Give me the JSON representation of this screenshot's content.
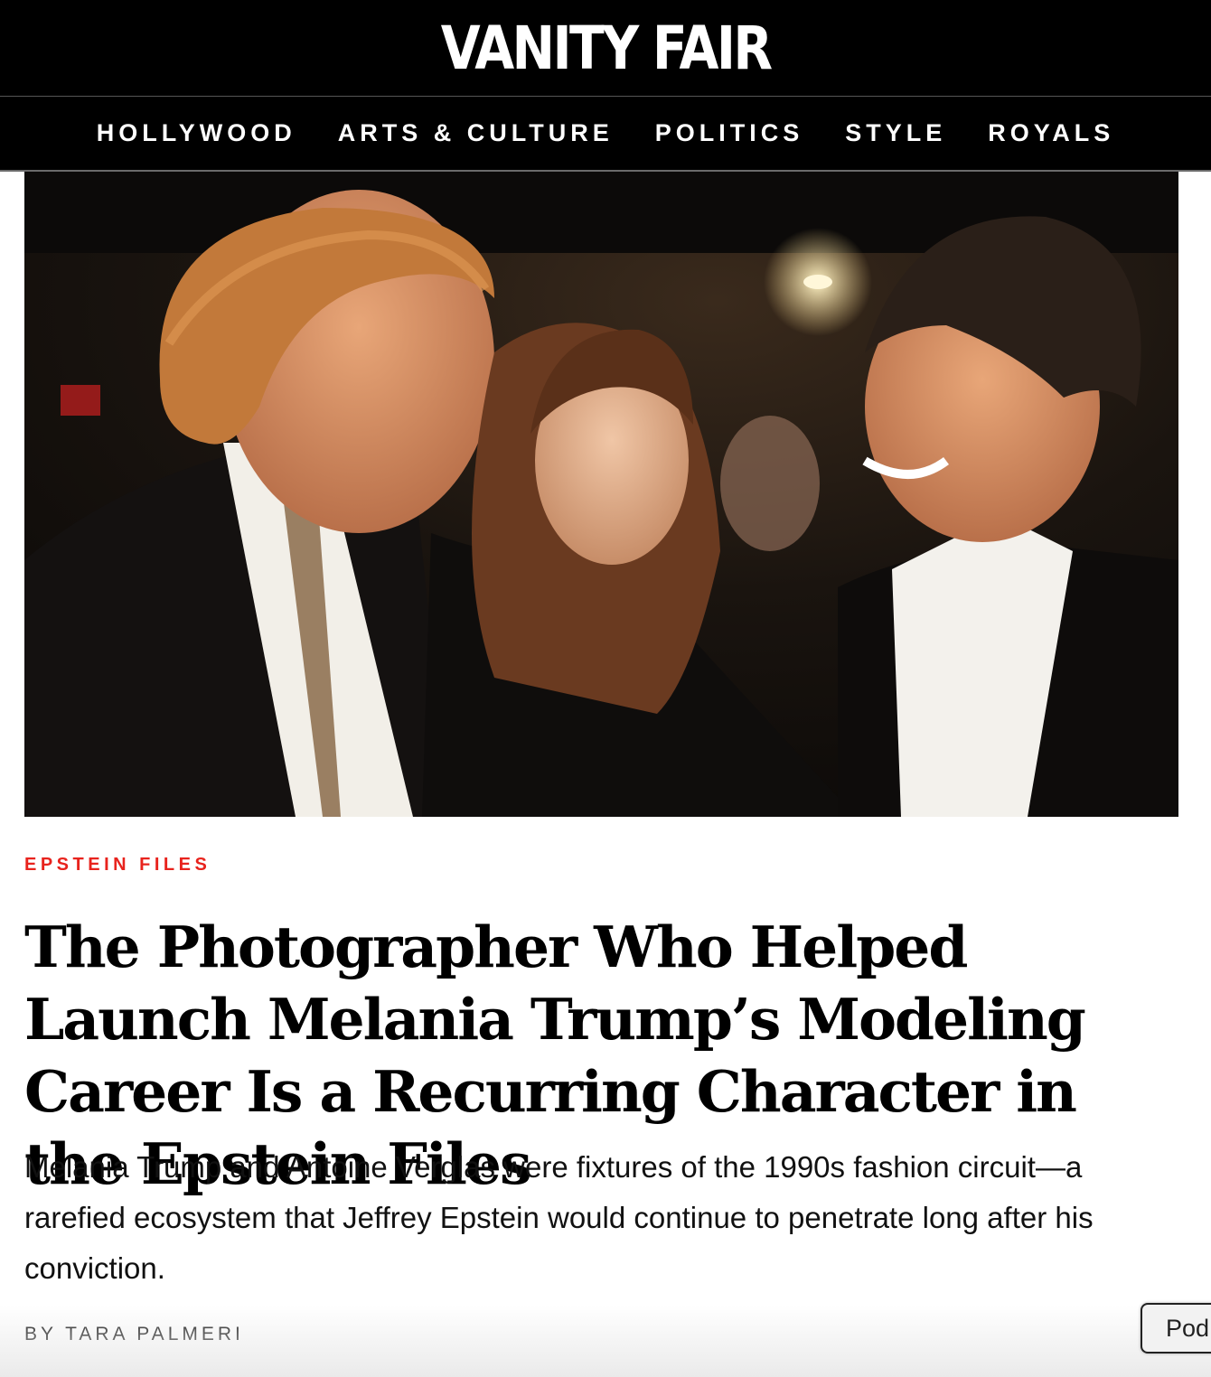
{
  "site": {
    "logo": "VANITY FAIR"
  },
  "nav": {
    "items": [
      {
        "label": "HOLLYWOOD"
      },
      {
        "label": "ARTS & CULTURE"
      },
      {
        "label": "POLITICS"
      },
      {
        "label": "STYLE"
      },
      {
        "label": "ROYALS"
      }
    ]
  },
  "article": {
    "rubric": "EPSTEIN FILES",
    "headline": "The Photographer Who Helped Launch Melania Trump’s Modeling Career Is a Recurring Character in the Epstein Files",
    "dek": "Melania Trump and Antoine Verglas were fixtures of the 1990s fashion circuit—a rarefied ecosystem that Jeffrey Epstein would continue to penetrate long after his conviction.",
    "byline_prefix": "BY",
    "author": "TARA PALMERI"
  },
  "floating_button": {
    "label": "Pod"
  },
  "colors": {
    "rubric": "#e8231d",
    "masthead": "#000000"
  }
}
